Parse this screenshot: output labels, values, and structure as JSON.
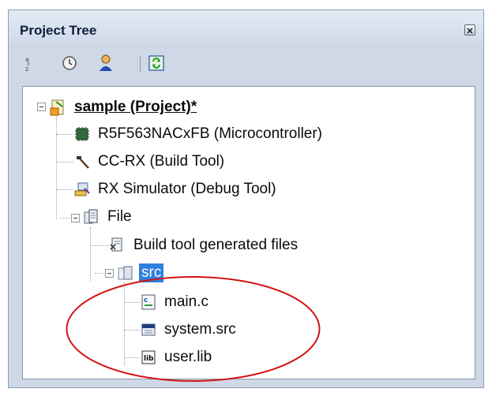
{
  "panel": {
    "title": "Project Tree"
  },
  "toolbar": {
    "buttons": [
      {
        "name": "sort-icon"
      },
      {
        "name": "clock-icon"
      },
      {
        "name": "person-icon"
      },
      {
        "name": "refresh-icon"
      }
    ]
  },
  "tree": {
    "project": "sample (Project)*",
    "microcontroller": "R5F563NACxFB (Microcontroller)",
    "build_tool": "CC-RX (Build Tool)",
    "debug_tool": "RX Simulator (Debug Tool)",
    "file_folder": "File",
    "generated_files": "Build tool generated files",
    "src_folder": "src",
    "files": [
      "main.c",
      "system.src",
      "user.lib"
    ]
  },
  "colors": {
    "selection": "#2f7fe0",
    "annotation": "#d21414"
  }
}
